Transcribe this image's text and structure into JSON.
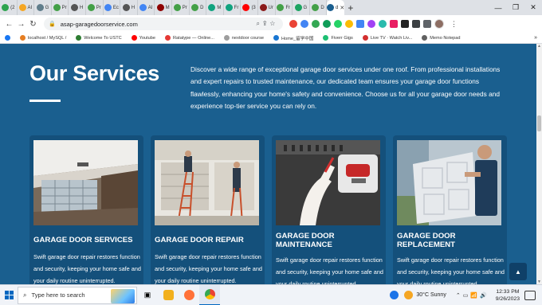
{
  "browser": {
    "tabs": [
      {
        "label": "(2",
        "color": "#2da44e"
      },
      {
        "label": "AI",
        "color": "#f5a623"
      },
      {
        "label": "G",
        "color": "#607d8b"
      },
      {
        "label": "Pr",
        "color": "#43a047"
      },
      {
        "label": "H",
        "color": "#555555"
      },
      {
        "label": "Pr",
        "color": "#43a047"
      },
      {
        "label": "Ec",
        "color": "#4285f4"
      },
      {
        "label": "H",
        "color": "#555555"
      },
      {
        "label": "AI",
        "color": "#4285f4"
      },
      {
        "label": "M",
        "color": "#8e0000"
      },
      {
        "label": "Pr",
        "color": "#43a047"
      },
      {
        "label": "D",
        "color": "#43a047"
      },
      {
        "label": "M",
        "color": "#10a37f"
      },
      {
        "label": "Fr",
        "color": "#10a37f"
      },
      {
        "label": "(3",
        "color": "#ff0000"
      },
      {
        "label": "Ur",
        "color": "#8b1a1a"
      },
      {
        "label": "Fr",
        "color": "#43a047"
      },
      {
        "label": "G",
        "color": "#1da462"
      },
      {
        "label": "D",
        "color": "#43a047"
      },
      {
        "label": "d",
        "color": "#1a5f8f"
      }
    ],
    "active_tab_index": 19,
    "new_tab_glyph": "+",
    "url": "asap-garagedoorservice.com",
    "bookmarks": [
      {
        "label": "localhost / MySQL /",
        "color": "#e67e22"
      },
      {
        "label": "Welcome To USTC",
        "color": "#2e7d32"
      },
      {
        "label": "Youtube",
        "color": "#ff0000"
      },
      {
        "label": "Ratatype — Online...",
        "color": "#e53935"
      },
      {
        "label": "nextdoor course",
        "color": "#9e9e9e"
      },
      {
        "label": "Home_留学中国",
        "color": "#1976d2"
      },
      {
        "label": "Fiverr Gigs",
        "color": "#1dbf73"
      },
      {
        "label": "Live TV · Watch Liv...",
        "color": "#d32f2f"
      },
      {
        "label": "Memo Notepad",
        "color": "#616161"
      }
    ],
    "bookmarks_more": "»"
  },
  "page": {
    "heading": "Our Services",
    "intro": "Discover a wide range of exceptional garage door services under one roof. From professional installations and expert repairs to trusted maintenance, our dedicated team ensures your garage door functions flawlessly, enhancing your home's safety and convenience. Choose us for all your garage door needs and experience top-tier service you can rely on.",
    "services": [
      {
        "title": "GARAGE DOOR SERVICES",
        "description": "Swift garage door repair restores function and security, keeping your home safe and your daily routine uninterrupted."
      },
      {
        "title": "GARAGE DOOR REPAIR",
        "description": "Swift garage door repair restores function and security, keeping your home safe and your daily routine uninterrupted."
      },
      {
        "title": "GARAGE DOOR MAINTENANCE",
        "description": "Swift garage door repair restores function and security, keeping your home safe and your daily routine uninterrupted."
      },
      {
        "title": "GARAGE DOOR REPLACEMENT",
        "description": "Swift garage door repair restores function and security, keeping your home safe and your daily routine uninterrupted."
      }
    ],
    "back_to_top_glyph": "▲"
  },
  "taskbar": {
    "search_placeholder": "Type here to search",
    "weather": "30°C  Sunny",
    "time": "12:33 PM",
    "date": "9/26/2023"
  },
  "colors": {
    "page_background": "#1a5f8f",
    "card_background": "#14507b",
    "accent_blue": "#0067c0"
  }
}
